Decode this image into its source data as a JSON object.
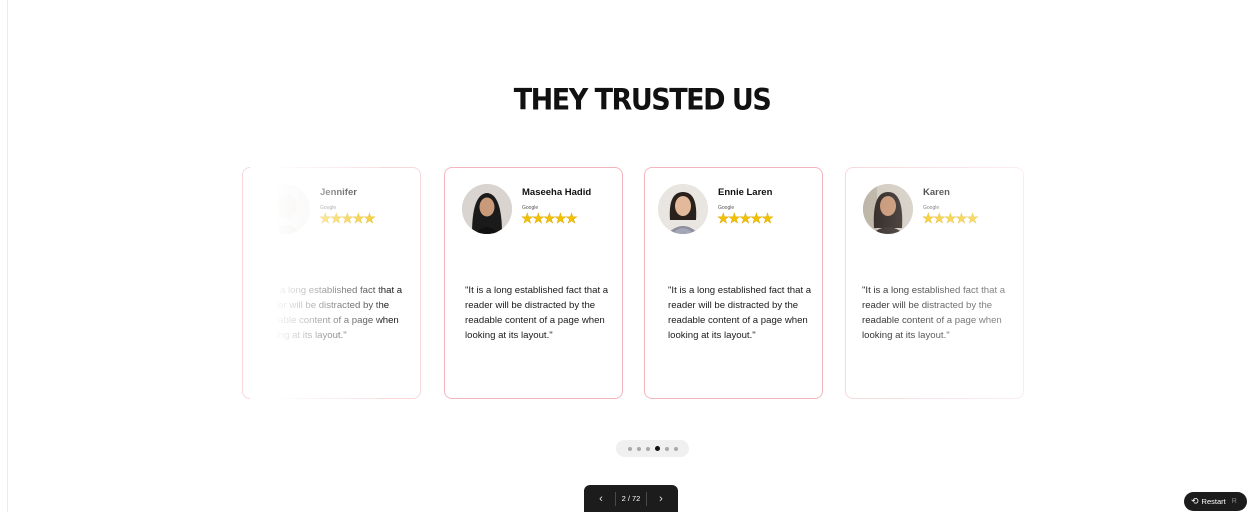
{
  "section": {
    "title": "THEY TRUSTED US"
  },
  "testimonials": [
    {
      "name": "Jennifer",
      "source": "Google",
      "rating": 5,
      "stars": "★★★★★",
      "quote": "\"It is a long established fact that a reader will be distracted by the readable content of a page when looking at its layout.\""
    },
    {
      "name": "Maseeha Hadid",
      "source": "Google",
      "rating": 5,
      "stars": "★★★★★",
      "quote": "\"It is a long established fact that a reader will be distracted by the readable content of a page when looking at its layout.\""
    },
    {
      "name": "Ennie Laren",
      "source": "Google",
      "rating": 5,
      "stars": "★★★★★",
      "quote": "\"It is a long established fact that a reader will be distracted by the readable content of a page when looking at its layout.\""
    },
    {
      "name": "Karen",
      "source": "Google",
      "rating": 5,
      "stars": "★★★★★",
      "quote": "\"It is a long established fact that a reader will be distracted by the readable content of a page when looking at its layout.\""
    }
  ],
  "carousel_dots": {
    "count": 6,
    "active_index": 3
  },
  "pager": {
    "prev_icon": "chevron-left-icon",
    "next_icon": "chevron-right-icon",
    "prev_glyph": "‹",
    "next_glyph": "›",
    "counter": "2 / 72"
  },
  "restart": {
    "label": "Restart",
    "key": "R",
    "icon": "restart-icon",
    "glyph": "⟲"
  },
  "colors": {
    "card_border": "#f3b6bd",
    "star": "#f2c200",
    "dark_control": "#1c1c1c"
  }
}
